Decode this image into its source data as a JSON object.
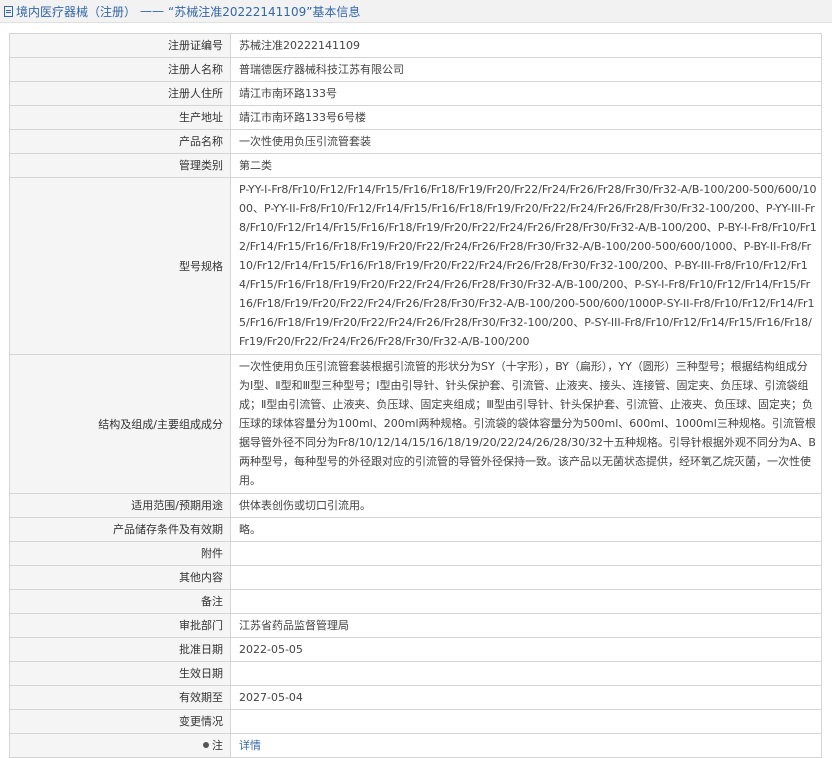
{
  "header": {
    "section_label": "境内医疗器械（注册）",
    "separator": "——",
    "title": "“苏械注准20222141109”基本信息"
  },
  "rows": [
    {
      "label": "注册证编号",
      "value": "苏械注准20222141109"
    },
    {
      "label": "注册人名称",
      "value": "普瑞德医疗器械科技江苏有限公司"
    },
    {
      "label": "注册人住所",
      "value": "靖江市南环路133号"
    },
    {
      "label": "生产地址",
      "value": "靖江市南环路133号6号楼"
    },
    {
      "label": "产品名称",
      "value": "一次性使用负压引流管套装"
    },
    {
      "label": "管理类别",
      "value": "第二类"
    },
    {
      "label": "型号规格",
      "value": "P-YY-I-Fr8/Fr10/Fr12/Fr14/Fr15/Fr16/Fr18/Fr19/Fr20/Fr22/Fr24/Fr26/Fr28/Fr30/Fr32-A/B-100/200-500/600/1000、P-YY-II-Fr8/Fr10/Fr12/Fr14/Fr15/Fr16/Fr18/Fr19/Fr20/Fr22/Fr24/Fr26/Fr28/Fr30/Fr32-100/200、P-YY-III-Fr8/Fr10/Fr12/Fr14/Fr15/Fr16/Fr18/Fr19/Fr20/Fr22/Fr24/Fr26/Fr28/Fr30/Fr32-A/B-100/200、P-BY-I-Fr8/Fr10/Fr12/Fr14/Fr15/Fr16/Fr18/Fr19/Fr20/Fr22/Fr24/Fr26/Fr28/Fr30/Fr32-A/B-100/200-500/600/1000、P-BY-II-Fr8/Fr10/Fr12/Fr14/Fr15/Fr16/Fr18/Fr19/Fr20/Fr22/Fr24/Fr26/Fr28/Fr30/Fr32-100/200、P-BY-III-Fr8/Fr10/Fr12/Fr14/Fr15/Fr16/Fr18/Fr19/Fr20/Fr22/Fr24/Fr26/Fr28/Fr30/Fr32-A/B-100/200、P-SY-I-Fr8/Fr10/Fr12/Fr14/Fr15/Fr16/Fr18/Fr19/Fr20/Fr22/Fr24/Fr26/Fr28/Fr30/Fr32-A/B-100/200-500/600/1000P-SY-II-Fr8/Fr10/Fr12/Fr14/Fr15/Fr16/Fr18/Fr19/Fr20/Fr22/Fr24/Fr26/Fr28/Fr30/Fr32-100/200、P-SY-III-Fr8/Fr10/Fr12/Fr14/Fr15/Fr16/Fr18/Fr19/Fr20/Fr22/Fr24/Fr26/Fr28/Fr30/Fr32-A/B-100/200"
    },
    {
      "label": "结构及组成/主要组成成分",
      "value": "一次性使用负压引流管套装根据引流管的形状分为SY（十字形），BY（扁形），YY（圆形）三种型号；根据结构组成分为Ⅰ型、Ⅱ型和Ⅲ型三种型号；Ⅰ型由引导针、针头保护套、引流管、止液夹、接头、连接管、固定夹、负压球、引流袋组成；Ⅱ型由引流管、止液夹、负压球、固定夹组成；Ⅲ型由引导针、针头保护套、引流管、止液夹、负压球、固定夹；负压球的球体容量分为100ml、200ml两种规格。引流袋的袋体容量分为500ml、600ml、1000ml三种规格。引流管根据导管外径不同分为Fr8/10/12/14/15/16/18/19/20/22/24/26/28/30/32十五种规格。引导针根据外观不同分为A、B两种型号，每种型号的外径跟对应的引流管的导管外径保持一致。该产品以无菌状态提供，经环氧乙烷灭菌，一次性使用。"
    },
    {
      "label": "适用范围/预期用途",
      "value": "供体表创伤或切口引流用。"
    },
    {
      "label": "产品储存条件及有效期",
      "value": "略。"
    },
    {
      "label": "附件",
      "value": ""
    },
    {
      "label": "其他内容",
      "value": ""
    },
    {
      "label": "备注",
      "value": ""
    },
    {
      "label": "审批部门",
      "value": "江苏省药品监督管理局"
    },
    {
      "label": "批准日期",
      "value": "2022-05-05"
    },
    {
      "label": "生效日期",
      "value": ""
    },
    {
      "label": "有效期至",
      "value": "2027-05-04"
    },
    {
      "label": "变更情况",
      "value": ""
    }
  ],
  "footer_row": {
    "label": "注",
    "link_text": "详情",
    "icon": "pin-icon"
  },
  "colors": {
    "link": "#3367a8",
    "label_bg": "#f5f5f5",
    "border": "#d4d4d4"
  }
}
